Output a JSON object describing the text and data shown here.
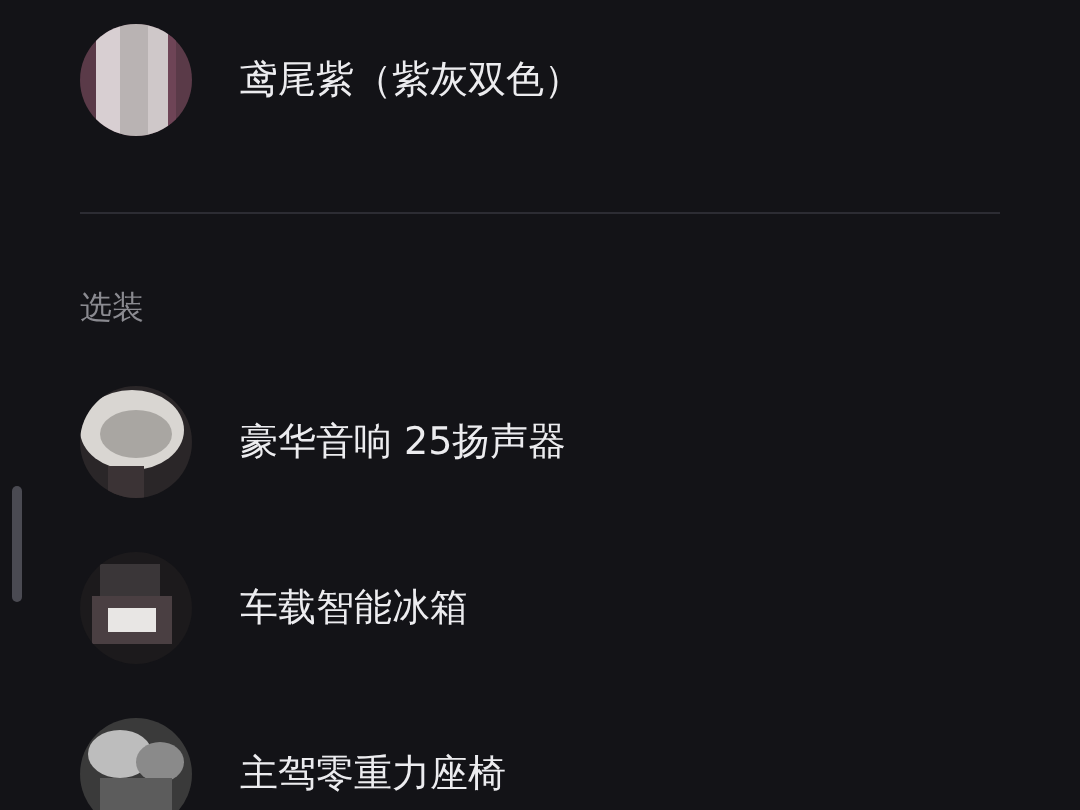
{
  "colors": [
    {
      "name": "鸢尾紫（紫灰双色）"
    }
  ],
  "section_title": "选装",
  "options": [
    {
      "name": "豪华音响 25扬声器"
    },
    {
      "name": "车载智能冰箱"
    },
    {
      "name": "主驾零重力座椅"
    }
  ]
}
